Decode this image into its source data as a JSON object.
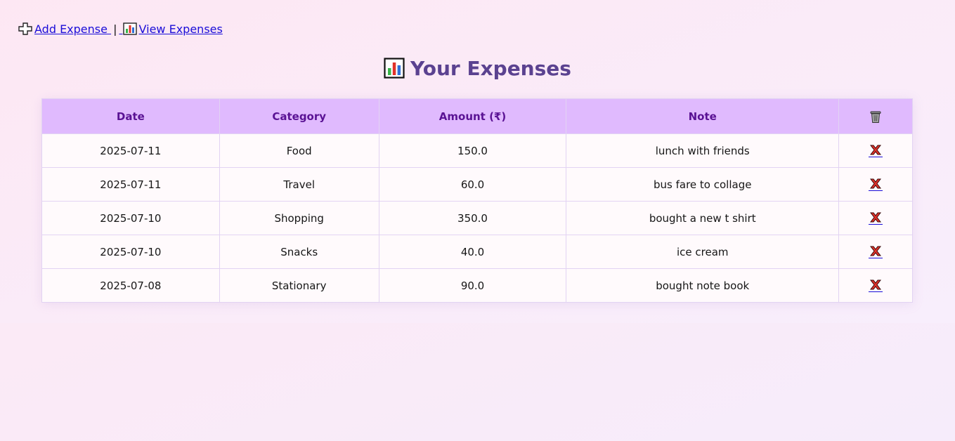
{
  "nav": {
    "add_label": "Add Expense",
    "add_icon": "heavy-plus-icon",
    "separator": "|",
    "view_label": "View Expenses",
    "view_icon": "bar-chart-icon"
  },
  "page": {
    "title": "Your Expenses",
    "title_icon": "bar-chart-icon"
  },
  "table": {
    "headers": [
      "Date",
      "Category",
      "Amount (₹)",
      "Note"
    ],
    "delete_header_icon": "wastebasket-icon",
    "rows": [
      {
        "date": "2025-07-11",
        "category": "Food",
        "amount": "150.0",
        "note": "lunch with friends"
      },
      {
        "date": "2025-07-11",
        "category": "Travel",
        "amount": "60.0",
        "note": "bus fare to collage"
      },
      {
        "date": "2025-07-10",
        "category": "Shopping",
        "amount": "350.0",
        "note": "bought a new t shirt"
      },
      {
        "date": "2025-07-10",
        "category": "Snacks",
        "amount": "40.0",
        "note": "ice cream"
      },
      {
        "date": "2025-07-08",
        "category": "Stationary",
        "amount": "90.0",
        "note": "bought note book"
      }
    ],
    "delete_icon": "cross-mark-icon"
  },
  "colors": {
    "link": "#1a0dd8",
    "title": "#5b4290",
    "header_bg": "#e0bafe",
    "header_text": "#5a1294"
  }
}
